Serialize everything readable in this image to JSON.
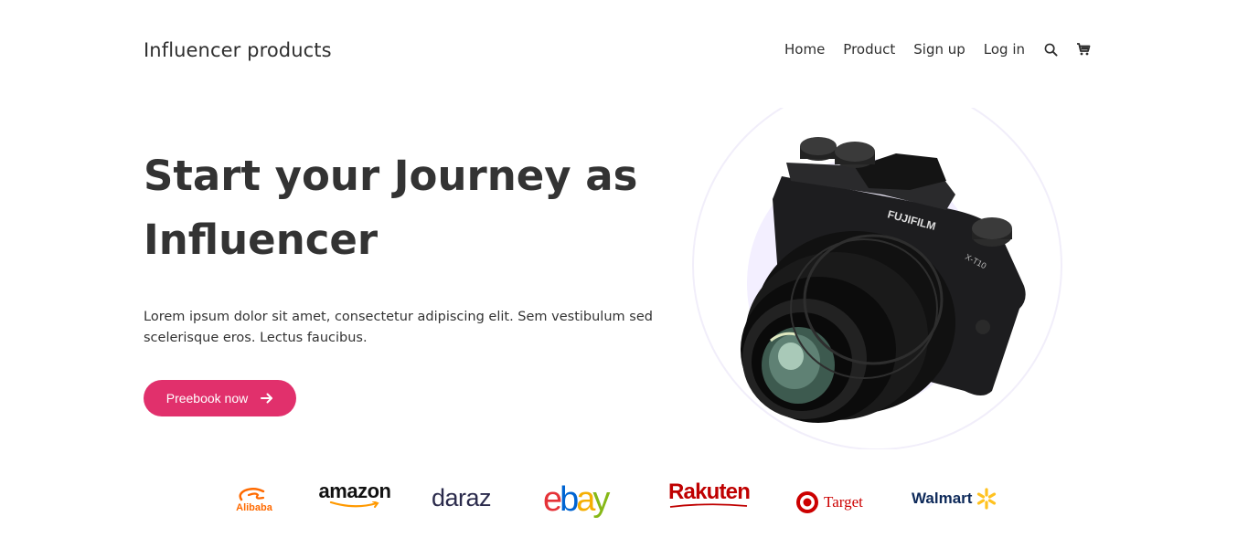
{
  "header": {
    "brand": "Influencer products",
    "nav": [
      {
        "label": "Home"
      },
      {
        "label": "Product"
      },
      {
        "label": "Sign up"
      },
      {
        "label": "Log in"
      }
    ],
    "icons": [
      "search-icon",
      "cart-icon"
    ]
  },
  "hero": {
    "title": "Start your Journey as Influencer",
    "description": "Lorem ipsum dolor sit amet, consectetur adipiscing elit. Sem vestibulum sed scelerisque eros. Lectus faucibus.",
    "cta_label": "Preebook now",
    "image_alt_icon": "camera-icon"
  },
  "brands": [
    {
      "name": "Alibaba",
      "color": "#ff6a00"
    },
    {
      "name": "amazon",
      "color": "#111111"
    },
    {
      "name": "daraz",
      "color": "#2b2b4c"
    },
    {
      "name": "ebay",
      "colors": [
        "#e53238",
        "#0064d2",
        "#f5af02",
        "#86b817"
      ]
    },
    {
      "name": "Rakuten",
      "color": "#bf0000"
    },
    {
      "name": "Target",
      "color": "#cc0000"
    },
    {
      "name": "Walmart",
      "color": "#0e2a5a",
      "spark_color": "#ffc220"
    }
  ],
  "colors": {
    "accent": "#e1306c",
    "text": "#333333",
    "circle_bg": "#f3efff"
  }
}
